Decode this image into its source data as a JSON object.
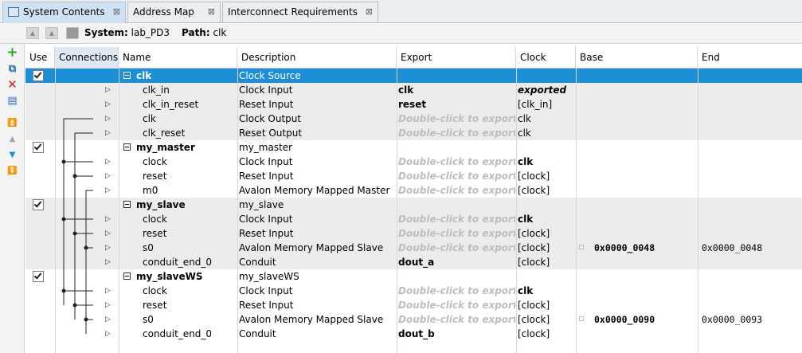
{
  "tabs": [
    {
      "label": "System Contents",
      "active": true
    },
    {
      "label": "Address Map",
      "active": false
    },
    {
      "label": "Interconnect Requirements",
      "active": false
    }
  ],
  "path_bar": {
    "system_label": "System:",
    "system_value": "lab_PD3",
    "path_label": "Path:",
    "path_value": "clk"
  },
  "sidebar_icons": [
    "add-icon",
    "add-connection-icon",
    "remove-icon",
    "edit-icon",
    "move-top-icon",
    "move-up-icon",
    "move-down-icon",
    "move-bottom-icon"
  ],
  "columns": [
    "Use",
    "Connections",
    "Name",
    "Description",
    "Export",
    "Clock",
    "Base",
    "End"
  ],
  "rows": [
    {
      "kind": "component",
      "use": true,
      "name": "clk",
      "description": "Clock Source",
      "export": "",
      "clock": "",
      "base": "",
      "end": "",
      "selected": true
    },
    {
      "kind": "port",
      "name": "clk_in",
      "description": "Clock Input",
      "export": "clk",
      "export_style": "bold",
      "clock": "exported",
      "clock_style": "italic-bold",
      "base": "",
      "end": ""
    },
    {
      "kind": "port",
      "name": "clk_in_reset",
      "description": "Reset Input",
      "export": "reset",
      "export_style": "bold",
      "clock": "[clk_in]",
      "base": "",
      "end": ""
    },
    {
      "kind": "port",
      "name": "clk",
      "description": "Clock Output",
      "export": "Double-click to export",
      "export_style": "hint",
      "clock": "clk",
      "base": "",
      "end": ""
    },
    {
      "kind": "port",
      "name": "clk_reset",
      "description": "Reset Output",
      "export": "Double-click to export",
      "export_style": "hint",
      "clock": "clk",
      "base": "",
      "end": ""
    },
    {
      "kind": "component",
      "use": true,
      "name": "my_master",
      "description": "my_master",
      "export": "",
      "clock": "",
      "base": "",
      "end": ""
    },
    {
      "kind": "port",
      "name": "clock",
      "description": "Clock Input",
      "export": "Double-click to export",
      "export_style": "hint",
      "clock": "clk",
      "clock_style": "bold",
      "base": "",
      "end": ""
    },
    {
      "kind": "port",
      "name": "reset",
      "description": "Reset Input",
      "export": "Double-click to export",
      "export_style": "hint",
      "clock": "[clock]",
      "base": "",
      "end": ""
    },
    {
      "kind": "port",
      "name": "m0",
      "description": "Avalon Memory Mapped Master",
      "export": "Double-click to export",
      "export_style": "hint",
      "clock": "[clock]",
      "base": "",
      "end": ""
    },
    {
      "kind": "component",
      "use": true,
      "name": "my_slave",
      "description": "my_slave",
      "export": "",
      "clock": "",
      "base": "",
      "end": ""
    },
    {
      "kind": "port",
      "name": "clock",
      "description": "Clock Input",
      "export": "Double-click to export",
      "export_style": "hint",
      "clock": "clk",
      "clock_style": "bold",
      "base": "",
      "end": ""
    },
    {
      "kind": "port",
      "name": "reset",
      "description": "Reset Input",
      "export": "Double-click to export",
      "export_style": "hint",
      "clock": "[clock]",
      "base": "",
      "end": ""
    },
    {
      "kind": "port",
      "name": "s0",
      "description": "Avalon Memory Mapped Slave",
      "export": "Double-click to export",
      "export_style": "hint",
      "clock": "[clock]",
      "base": "0x0000_0048",
      "end": "0x0000_0048"
    },
    {
      "kind": "port",
      "name": "conduit_end_0",
      "description": "Conduit",
      "export": "dout_a",
      "export_style": "bold",
      "clock": "[clock]",
      "base": "",
      "end": ""
    },
    {
      "kind": "component",
      "use": true,
      "name": "my_slaveWS",
      "description": "my_slaveWS",
      "export": "",
      "clock": "",
      "base": "",
      "end": ""
    },
    {
      "kind": "port",
      "name": "clock",
      "description": "Clock Input",
      "export": "Double-click to export",
      "export_style": "hint",
      "clock": "clk",
      "clock_style": "bold",
      "base": "",
      "end": ""
    },
    {
      "kind": "port",
      "name": "reset",
      "description": "Reset Input",
      "export": "Double-click to export",
      "export_style": "hint",
      "clock": "[clock]",
      "base": "",
      "end": ""
    },
    {
      "kind": "port",
      "name": "s0",
      "description": "Avalon Memory Mapped Slave",
      "export": "Double-click to export",
      "export_style": "hint",
      "clock": "[clock]",
      "base": "0x0000_0090",
      "end": "0x0000_0093"
    },
    {
      "kind": "port",
      "name": "conduit_end_0",
      "description": "Conduit",
      "export": "dout_b",
      "export_style": "bold",
      "clock": "[clock]",
      "base": "",
      "end": ""
    }
  ],
  "colors": {
    "selection": "#1c8fd8",
    "header_active": "#dfe9f4",
    "hint_text": "#bdbdbd"
  }
}
